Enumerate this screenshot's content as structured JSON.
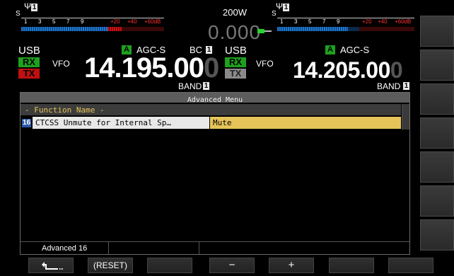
{
  "top": {
    "power": "200W",
    "freq_offset": "0.000"
  },
  "main": {
    "mode": "USB",
    "vfo": "VFO",
    "agc": "AGC-S",
    "antenna_letter": "A",
    "bc_label": "BC",
    "bc_num": "1",
    "freq_main": "14.195.00",
    "freq_dim_digit": "0",
    "band_label": "BAND",
    "band_num": "1",
    "rx": "RX",
    "tx": "TX",
    "antenna_num": "1",
    "meter_scale": [
      "S",
      "1",
      "3",
      "5",
      "7",
      "9",
      "+20",
      "+40",
      "+60dB"
    ]
  },
  "sub": {
    "mode": "USB",
    "vfo": "VFO",
    "agc": "AGC-S",
    "antenna_letter": "A",
    "freq_main": "14.205.00",
    "freq_dim_digit": "0",
    "band_label": "BAND",
    "band_num": "1",
    "rx": "RX",
    "tx": "TX",
    "antenna_num": "1",
    "meter_scale": [
      "S",
      "1",
      "3",
      "5",
      "7",
      "9",
      "+20",
      "+40",
      "+60dB"
    ]
  },
  "menu": {
    "title": "Advanced Menu",
    "column_header": "- Function Name -",
    "rows": [
      {
        "number": "16",
        "name": "CTCSS Unmute for Internal Sp…",
        "value": "Mute"
      }
    ],
    "status_left": "Advanced 16"
  },
  "function_keys": [
    {
      "label": "",
      "icon": "return-arrow-icon"
    },
    {
      "label": "(RESET)"
    },
    {
      "label": ""
    },
    {
      "label": "−"
    },
    {
      "label": "+"
    },
    {
      "label": ""
    },
    {
      "label": ""
    }
  ]
}
